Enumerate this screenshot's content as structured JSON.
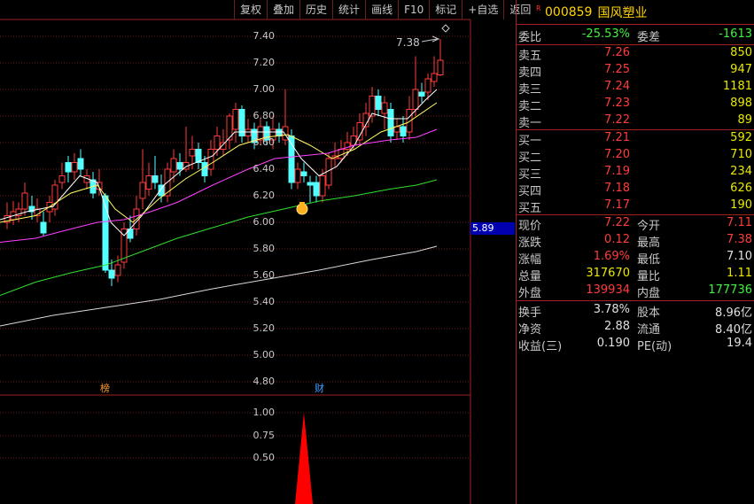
{
  "toolbar": {
    "buttons": [
      "复权",
      "叠加",
      "历史",
      "统计",
      "画线",
      "F10",
      "标记",
      "+自选",
      "返回"
    ]
  },
  "chart": {
    "price_axis": [
      "7.40",
      "7.20",
      "7.00",
      "6.80",
      "6.60",
      "6.40",
      "6.20",
      "6.00",
      "5.80",
      "5.60",
      "5.40",
      "5.20",
      "5.00",
      "4.80"
    ],
    "indicator_axis": [
      "1.00",
      "0.75",
      "0.50"
    ],
    "high_marker": "7.38",
    "current_price_box": "5.89",
    "badges": [
      "榜",
      "财"
    ],
    "colors": {
      "up": "#ff3c3c",
      "down": "#54ffff",
      "ma5": "#ffffff",
      "ma10": "#ffff60",
      "ma20": "#ff40ff",
      "ma60": "#30e030",
      "ma120": "#d8d8d8",
      "grid": "#6a1e1e",
      "indicator": "#ff0000"
    },
    "indicator_signal_level": 1.0
  },
  "quote": {
    "r_mark": "R",
    "code": "000859",
    "name": "国风塑业",
    "wei_bi_label": "委比",
    "wei_bi": "-25.53%",
    "wei_cha_label": "委差",
    "wei_cha": "-1613",
    "asks": [
      {
        "label": "卖五",
        "price": "7.26",
        "vol": "850"
      },
      {
        "label": "卖四",
        "price": "7.25",
        "vol": "947"
      },
      {
        "label": "卖三",
        "price": "7.24",
        "vol": "1181"
      },
      {
        "label": "卖二",
        "price": "7.23",
        "vol": "898"
      },
      {
        "label": "卖一",
        "price": "7.22",
        "vol": "89"
      }
    ],
    "bids": [
      {
        "label": "买一",
        "price": "7.21",
        "vol": "592"
      },
      {
        "label": "买二",
        "price": "7.20",
        "vol": "710"
      },
      {
        "label": "买三",
        "price": "7.19",
        "vol": "234"
      },
      {
        "label": "买四",
        "price": "7.18",
        "vol": "626"
      },
      {
        "label": "买五",
        "price": "7.17",
        "vol": "190"
      }
    ],
    "stats": [
      {
        "l1": "现价",
        "v1": "7.22",
        "c1": "red",
        "l2": "今开",
        "v2": "7.11",
        "c2": "red"
      },
      {
        "l1": "涨跌",
        "v1": "0.12",
        "c1": "red",
        "l2": "最高",
        "v2": "7.38",
        "c2": "red"
      },
      {
        "l1": "涨幅",
        "v1": "1.69%",
        "c1": "red",
        "l2": "最低",
        "v2": "7.10",
        "c2": "white"
      },
      {
        "l1": "总量",
        "v1": "317670",
        "c1": "yellow",
        "l2": "量比",
        "v2": "1.11",
        "c2": "yellow"
      },
      {
        "l1": "外盘",
        "v1": "139934",
        "c1": "red",
        "l2": "内盘",
        "v2": "177736",
        "c2": "green"
      }
    ],
    "fund": [
      {
        "l1": "换手",
        "v1": "3.78%",
        "l2": "股本",
        "v2": "8.96亿"
      },
      {
        "l1": "净资",
        "v1": "2.88",
        "l2": "流通",
        "v2": "8.40亿"
      },
      {
        "l1": "收益(三)",
        "v1": "0.190",
        "l2": "PE(动)",
        "v2": "19.4"
      }
    ]
  }
}
